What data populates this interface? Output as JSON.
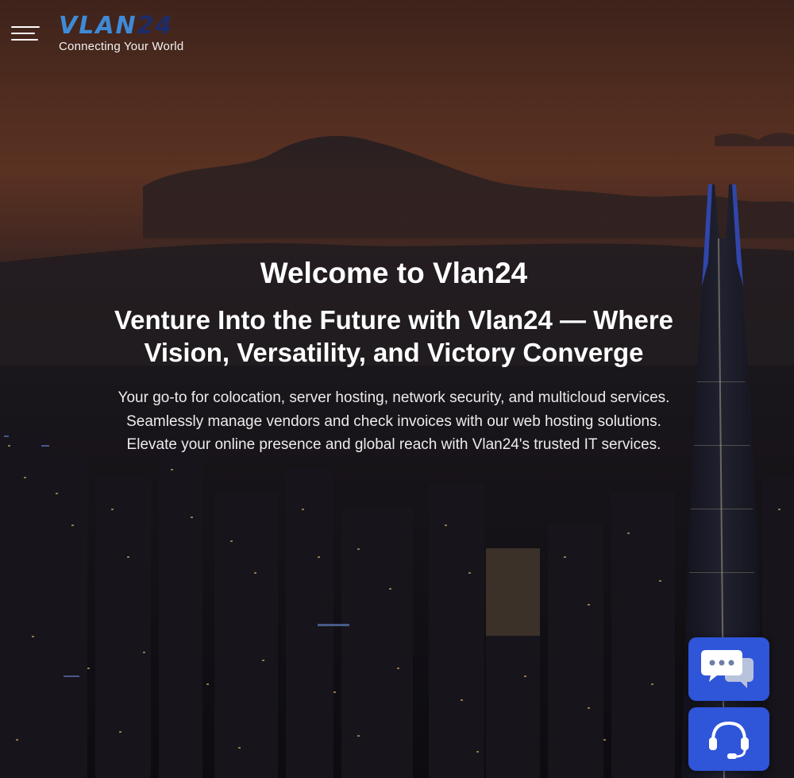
{
  "header": {
    "menu_icon": "hamburger-menu-icon",
    "logo": {
      "mark_part1": "VLAN",
      "mark_part2": "24",
      "tagline": "Connecting Your World",
      "colors": {
        "primary": "#3f8ad6",
        "secondary": "#1c2c6b"
      }
    }
  },
  "hero": {
    "title": "Welcome to Vlan24",
    "subtitle": "Venture Into the Future with Vlan24 — Where Vision, Versatility, and Victory Converge",
    "description": "Your go-to for colocation, server hosting, network security, and multicloud services. Seamlessly manage vendors and check invoices with our web hosting solutions. Elevate your online presence and global reach with Vlan24's trusted IT services."
  },
  "widgets": {
    "chat_icon": "chat-bubbles-icon",
    "support_icon": "headset-support-icon",
    "accent": "#2f55d9"
  }
}
